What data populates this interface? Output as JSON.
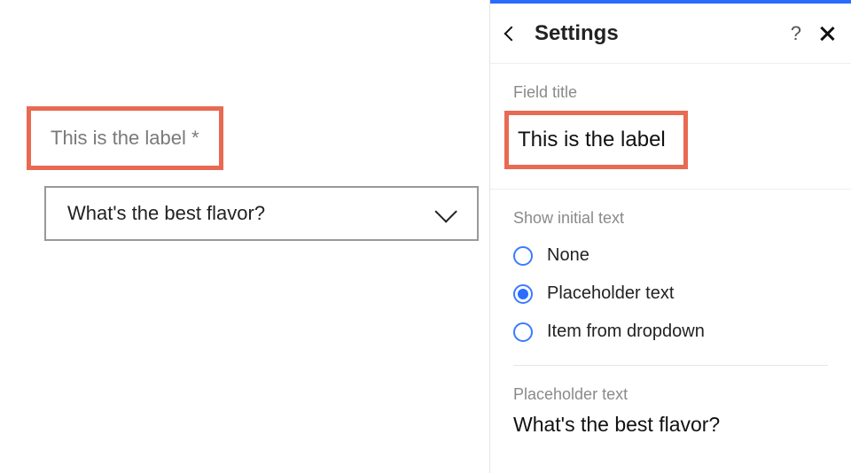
{
  "canvas": {
    "label": "This is the label *",
    "dropdown_placeholder": "What's the best flavor?"
  },
  "panel": {
    "title": "Settings",
    "help": "?",
    "field_title_section": {
      "label": "Field title",
      "value": "This is the label"
    },
    "initial_text": {
      "label": "Show initial text",
      "options": [
        {
          "label": "None",
          "checked": false
        },
        {
          "label": "Placeholder text",
          "checked": true
        },
        {
          "label": "Item from dropdown",
          "checked": false
        }
      ]
    },
    "placeholder_section": {
      "label": "Placeholder text",
      "value": "What's the best flavor?"
    }
  }
}
